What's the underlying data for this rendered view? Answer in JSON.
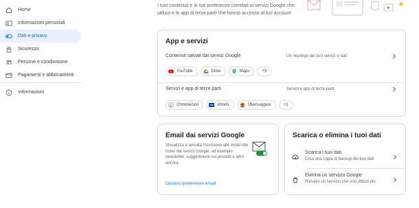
{
  "sidebar": {
    "items": [
      {
        "label": "Home",
        "icon": "home-icon"
      },
      {
        "label": "Informazioni personali",
        "icon": "person-card-icon"
      },
      {
        "label": "Dati e privacy",
        "icon": "toggle-icon"
      },
      {
        "label": "Sicurezza",
        "icon": "lock-icon"
      },
      {
        "label": "Persone e condivisione",
        "icon": "people-icon"
      },
      {
        "label": "Pagamenti e abbonamenti",
        "icon": "credit-card-icon"
      },
      {
        "label": "Informazioni",
        "icon": "info-icon"
      }
    ],
    "active_index": 2
  },
  "intro": {
    "text": "I tuoi contenuti e le tue preferenze correlati ai servizi Google che utilizzi e le app di terze parti che hanno accesso al tuo account"
  },
  "apps_card": {
    "title": "App e servizi",
    "saved_content": {
      "title": "Contenuti salvati dai servizi Google",
      "desc": "Un riepilogo dei tuoi servizi e dati",
      "chips": [
        {
          "label": "YouTube",
          "icon": "youtube-icon"
        },
        {
          "label": "Drive",
          "icon": "drive-icon"
        },
        {
          "label": "Maps",
          "icon": "maps-icon"
        }
      ],
      "more": "+3"
    },
    "third_party": {
      "title": "Servizi e app di terze parti",
      "desc": "Servizi e app di terze parti",
      "chips": [
        {
          "label": "Chromecast",
          "icon": "chromecast-icon"
        },
        {
          "label": "Ahrefs",
          "icon": "ahrefs-icon"
        },
        {
          "label": "Ubersuggest",
          "icon": "ubersuggest-icon"
        }
      ],
      "more": "+1"
    }
  },
  "email_card": {
    "title": "Email dai servizi Google",
    "desc": "Visualizza e annulla l'iscrizione alle email che ricevi dai servizi Google, ad esempio newsletter, suggerimenti sui prodotti e altro ancora",
    "link": "Gestisci preferenze email"
  },
  "download_card": {
    "title": "Scarica o elimina i tuoi dati",
    "rows": [
      {
        "title": "Scarica i tuoi dati",
        "desc": "Crea una copia di backup dei tuoi dati",
        "icon": "cloud-download-icon"
      },
      {
        "title": "Elimina un servizio Google",
        "desc": "Rimuovi un servizio che non utilizzi più",
        "icon": "trash-icon"
      }
    ]
  },
  "colors": {
    "active_bg": "#e8f0fe",
    "active_text": "#1967d2",
    "link": "#1a73e8",
    "border": "#dadce0"
  }
}
